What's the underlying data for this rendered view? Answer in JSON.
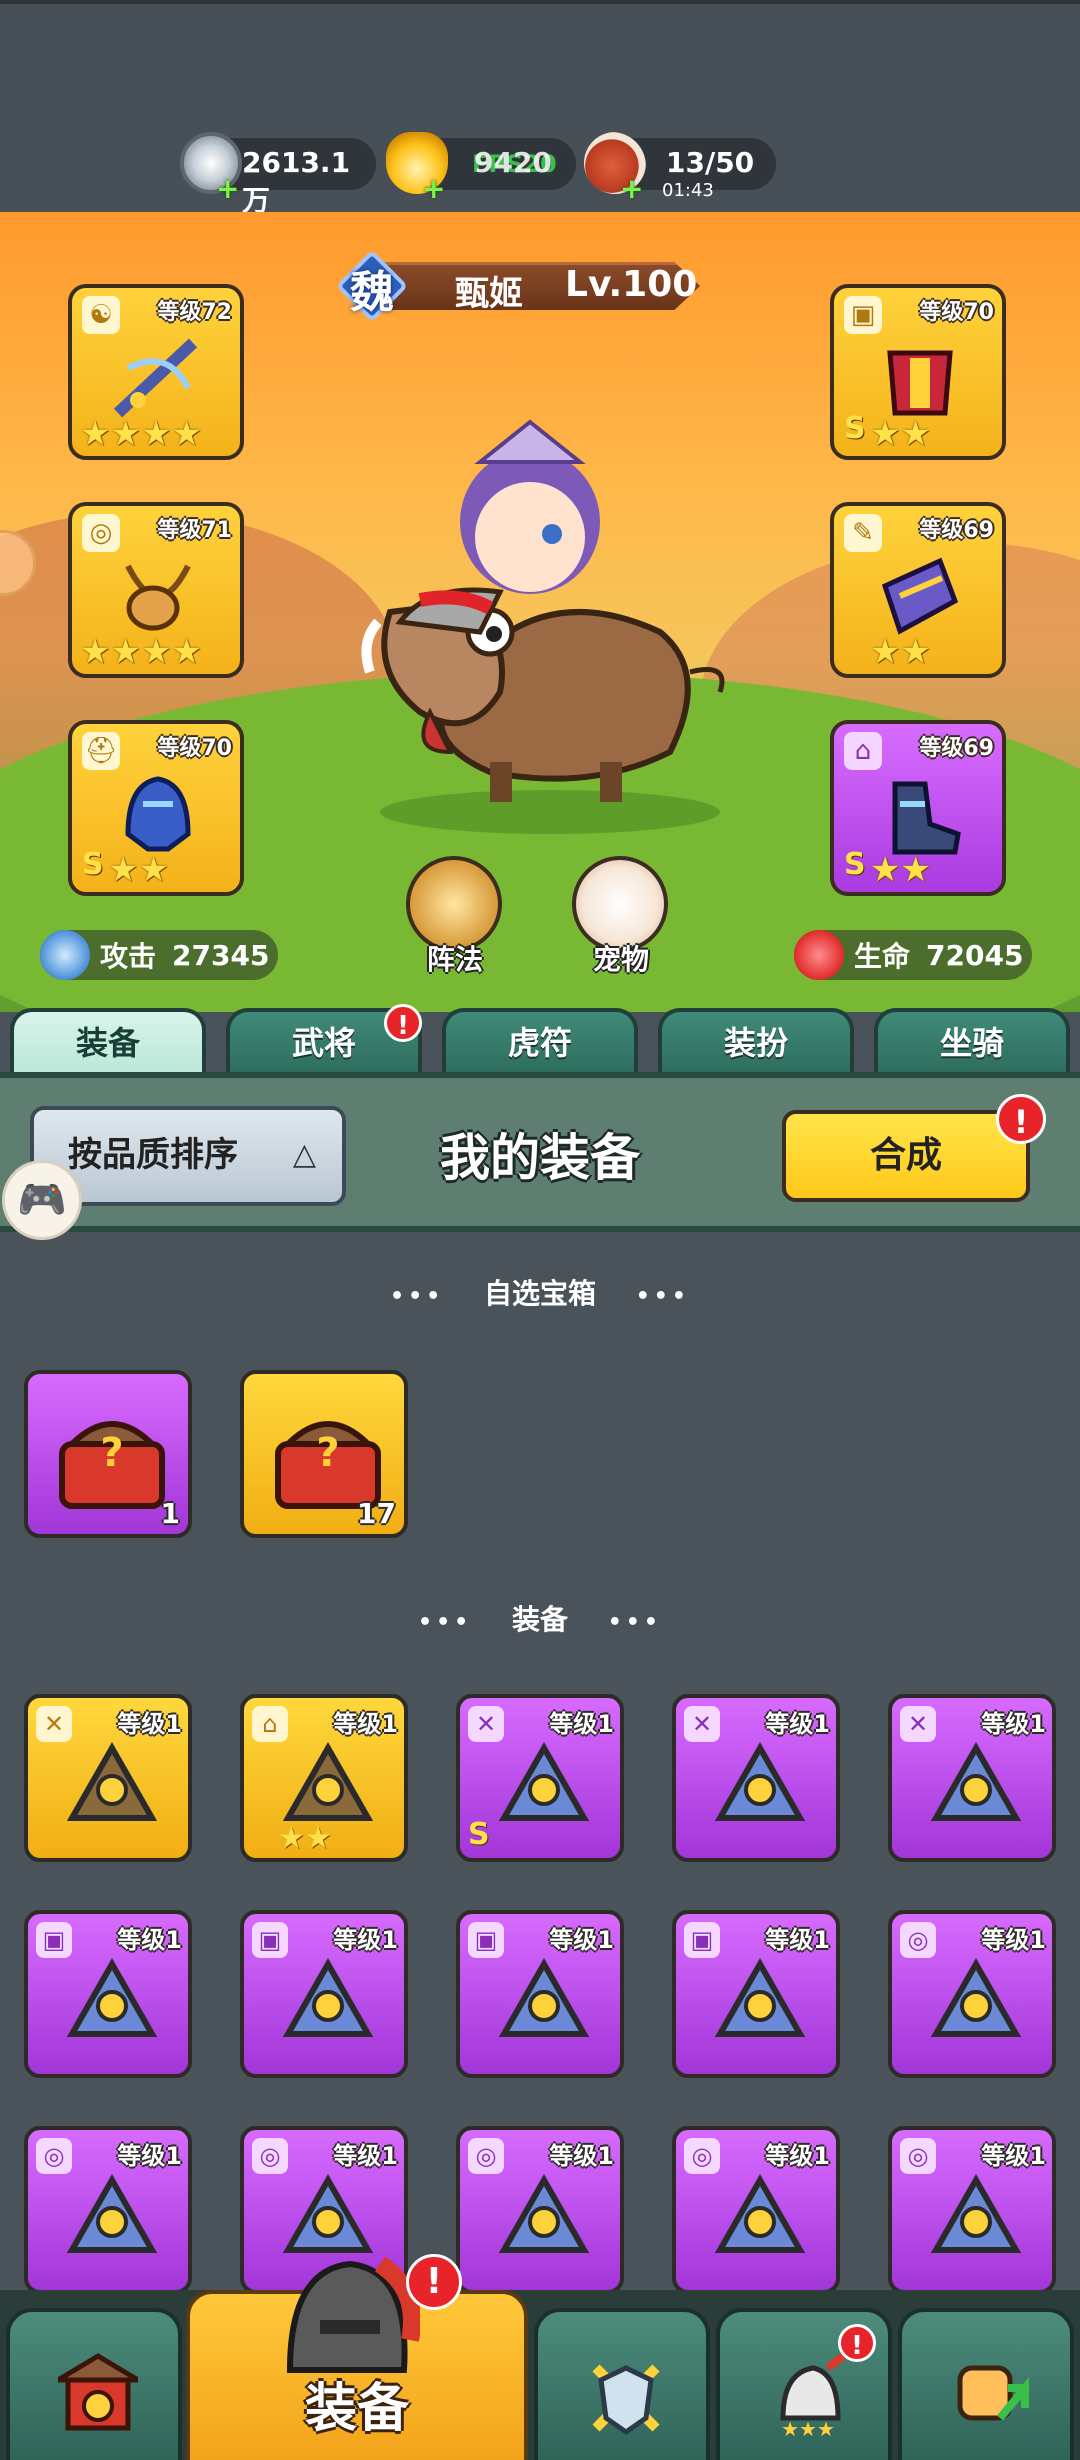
{
  "resources": {
    "silver": {
      "value": "2613.1万",
      "icon": "silver-coin-icon"
    },
    "gold": {
      "value": "9420",
      "overlay": "FPS20",
      "icon": "gold-ingot-icon"
    },
    "stamina": {
      "value": "13/50",
      "timer": "01:43",
      "icon": "meat-icon"
    }
  },
  "hero": {
    "kingdom": "魏",
    "name": "甄姬",
    "level": "Lv.100"
  },
  "stage_slots": [
    {
      "level": "等级72",
      "rarity": "gold",
      "stars": "★★★★",
      "rank": "",
      "tag": "☯"
    },
    {
      "level": "等级71",
      "rarity": "gold",
      "stars": "★★★★",
      "rank": "",
      "tag": "◎"
    },
    {
      "level": "等级70",
      "rarity": "gold",
      "stars": "★★",
      "rank": "S",
      "tag": "⛑"
    },
    {
      "level": "等级70",
      "rarity": "gold",
      "stars": "★★",
      "rank": "S",
      "tag": "▣"
    },
    {
      "level": "等级69",
      "rarity": "gold",
      "stars": "★★",
      "rank": "",
      "tag": "✎"
    },
    {
      "level": "等级69",
      "rarity": "purple",
      "stars": "★★",
      "rank": "S",
      "tag": "⌂"
    }
  ],
  "stats": {
    "attack_label": "攻击",
    "attack_value": "27345",
    "hp_label": "生命",
    "hp_value": "72045"
  },
  "round_buttons": {
    "formation": "阵法",
    "pet": "宠物"
  },
  "tabs": [
    "装备",
    "武将",
    "虎符",
    "装扮",
    "坐骑"
  ],
  "header": {
    "sort_label": "按品质排序",
    "title": "我的装备",
    "combine_label": "合成",
    "badge": "!"
  },
  "sections": {
    "chest_title": "自选宝箱",
    "equip_title": "装备",
    "dots": "•••"
  },
  "chests": [
    {
      "rarity": "purple",
      "count": "1"
    },
    {
      "rarity": "gold",
      "count": "17"
    }
  ],
  "equipment": [
    {
      "rarity": "gold",
      "level": "等级1",
      "tag": "✕",
      "stars": "",
      "rank": ""
    },
    {
      "rarity": "gold",
      "level": "等级1",
      "tag": "⌂",
      "stars": "★★",
      "rank": ""
    },
    {
      "rarity": "purple",
      "level": "等级1",
      "tag": "✕",
      "stars": "",
      "rank": "S"
    },
    {
      "rarity": "purple",
      "level": "等级1",
      "tag": "✕",
      "stars": "",
      "rank": ""
    },
    {
      "rarity": "purple",
      "level": "等级1",
      "tag": "✕",
      "stars": "",
      "rank": ""
    },
    {
      "rarity": "purple",
      "level": "等级1",
      "tag": "▣",
      "stars": "",
      "rank": ""
    },
    {
      "rarity": "purple",
      "level": "等级1",
      "tag": "▣",
      "stars": "",
      "rank": ""
    },
    {
      "rarity": "purple",
      "level": "等级1",
      "tag": "▣",
      "stars": "",
      "rank": ""
    },
    {
      "rarity": "purple",
      "level": "等级1",
      "tag": "▣",
      "stars": "",
      "rank": ""
    },
    {
      "rarity": "purple",
      "level": "等级1",
      "tag": "◎",
      "stars": "",
      "rank": ""
    },
    {
      "rarity": "purple",
      "level": "等级1",
      "tag": "◎",
      "stars": "",
      "rank": ""
    },
    {
      "rarity": "purple",
      "level": "等级1",
      "tag": "◎",
      "stars": "",
      "rank": ""
    },
    {
      "rarity": "purple",
      "level": "等级1",
      "tag": "◎",
      "stars": "",
      "rank": ""
    },
    {
      "rarity": "purple",
      "level": "等级1",
      "tag": "◎",
      "stars": "",
      "rank": ""
    },
    {
      "rarity": "purple",
      "level": "等级1",
      "tag": "◎",
      "stars": "",
      "rank": ""
    }
  ],
  "bottom_nav": {
    "active_label": "装备",
    "badge": "!"
  },
  "colors": {
    "gold_item": "#f1ae14",
    "purple_item": "#a236d8",
    "tab_green": "#2d6b5c",
    "badge_red": "#e8232a"
  }
}
